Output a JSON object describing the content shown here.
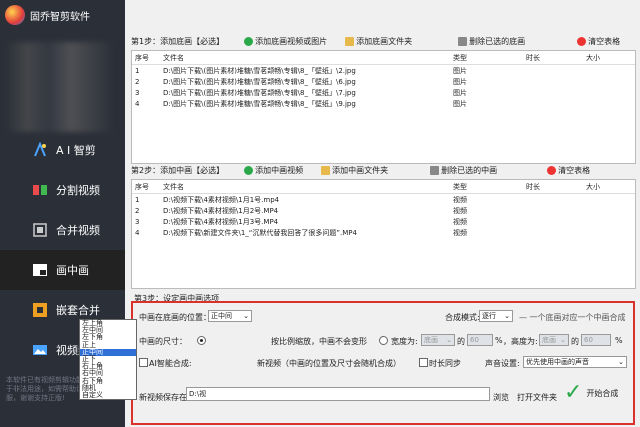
{
  "app": {
    "title": "固乔智剪软件"
  },
  "sidebar": {
    "items": [
      {
        "label": "A I 智剪",
        "icon": "ai-clip-icon"
      },
      {
        "label": "分割视频",
        "icon": "split-video-icon"
      },
      {
        "label": "合并视频",
        "icon": "merge-video-icon"
      },
      {
        "label": "画中画",
        "icon": "picture-in-picture-icon"
      },
      {
        "label": "嵌套合并",
        "icon": "nested-merge-icon"
      },
      {
        "label": "视频封面",
        "icon": "video-cover-icon"
      }
    ],
    "active": "画中画",
    "footer_note": "本软件已有视频剪辑功能，请勿用于非法用途，如需帮助请联系客服，谢谢支持正版!"
  },
  "step1": {
    "label": "第1步：添加底画【必选】",
    "add_button": "添加底画视频或图片",
    "add_folder_button": "添加底画文件夹",
    "delete_button": "删除已选的底画",
    "clear_button": "清空表格",
    "columns": [
      "序号",
      "文件名",
      "类型",
      "时长",
      "大小"
    ],
    "rows": [
      [
        "1",
        "D:\\图片下载\\(图片素材)堆糖\\雪茗颉畅\\专辑\\8_「壁纸」\\2.jpg",
        "图片",
        "",
        ""
      ],
      [
        "2",
        "D:\\图片下载\\(图片素材)堆糖\\雪茗颉畅\\专辑\\8_「壁纸」\\6.jpg",
        "图片",
        "",
        ""
      ],
      [
        "3",
        "D:\\图片下载\\(图片素材)堆糖\\雪茗颉畅\\专辑\\8_「壁纸」\\7.jpg",
        "图片",
        "",
        ""
      ],
      [
        "4",
        "D:\\图片下载\\(图片素材)堆糖\\雪茗颉畅\\专辑\\8_「壁纸」\\9.jpg",
        "图片",
        "",
        ""
      ]
    ]
  },
  "step2": {
    "label": "第2步：添加中画【必选】",
    "add_button": "添加中画视频",
    "add_folder_button": "添加中画文件夹",
    "delete_button": "删除已选的中画",
    "clear_button": "清空表格",
    "columns": [
      "序号",
      "文件名",
      "类型",
      "时长",
      "大小"
    ],
    "rows": [
      [
        "1",
        "D:\\视频下载\\4素材视频\\1月1号.mp4",
        "视频",
        "",
        ""
      ],
      [
        "2",
        "D:\\视频下载\\4素材视频\\1月2号.MP4",
        "视频",
        "",
        ""
      ],
      [
        "3",
        "D:\\视频下载\\4素材视频\\1月3号.MP4",
        "视频",
        "",
        ""
      ],
      [
        "4",
        "D:\\视频下载\\新建文件夹\\1_“沉默代替我回答了很多问题”.MP4",
        "视频",
        "",
        ""
      ]
    ]
  },
  "step3": {
    "label": "第3步：设定画中画选项",
    "position_label": "中画在底画的位置：",
    "position_value": "正中间",
    "position_options": [
      "左上角",
      "左中间",
      "左下角",
      "正上",
      "正中间",
      "正下",
      "右上角",
      "右中间",
      "右下角",
      "随机",
      "自定义"
    ],
    "position_highlight": "正中间",
    "size_label": "中画的尺寸：",
    "size_radio1_text": "按比例缩放，中画不会变形",
    "width_label": "宽度为:",
    "width_base": "底画",
    "width_of": "的",
    "width_pct": "60",
    "pct_sign": "%",
    "height_label": "，高度为:",
    "height_base": "底画",
    "height_of": "的",
    "height_pct": "60",
    "ai_label": "AI智能合成:",
    "ai_tail": "新视频（中画的位置及尺寸会随机合成）",
    "duration_sync": "时长同步",
    "mode_label": "合成模式:",
    "mode_value": "逐行",
    "mode_hint": "一个底画对应一个中画合成",
    "sound_label": "声音设置:",
    "sound_value": "优先使用中画的声音",
    "save_label": "新视频保存在:",
    "save_path": "D:\\视",
    "browse_button": "浏览",
    "open_folder_button": "打开文件夹",
    "start_button": "开始合成"
  }
}
